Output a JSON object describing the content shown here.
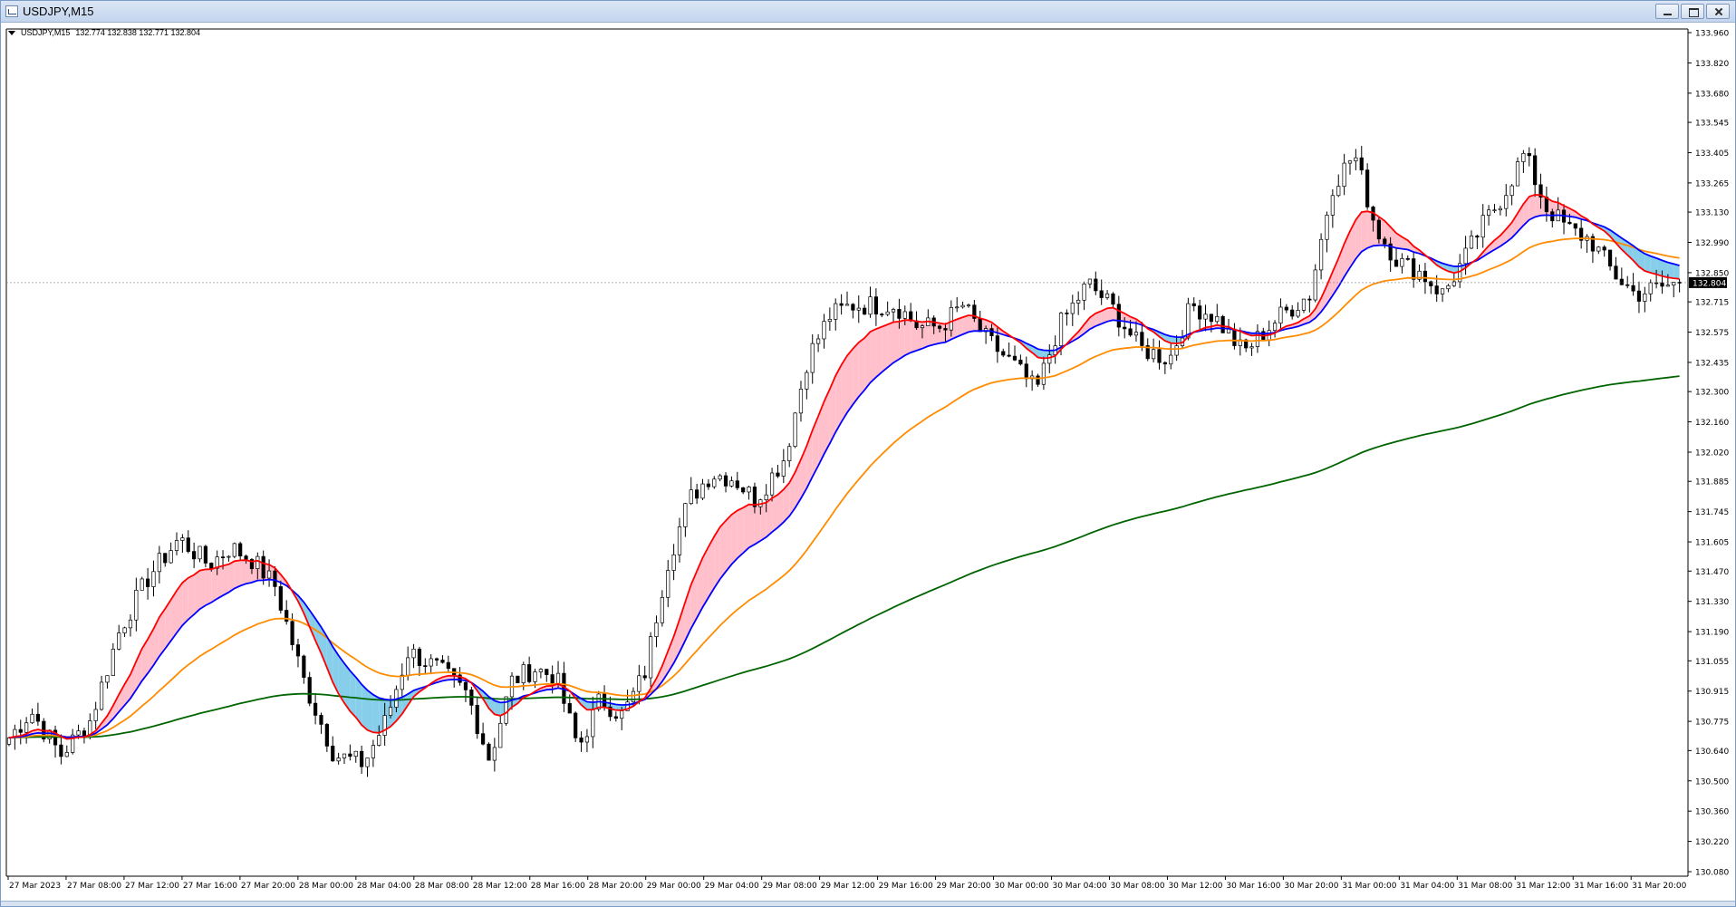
{
  "window": {
    "title": "USDJPY,M15",
    "title_icon": "chart-window-icon",
    "buttons": [
      "minimize",
      "maximize",
      "close"
    ]
  },
  "chart_header": {
    "symbol": "USDJPY,M15",
    "ohlc": "132.774 132.838 132.771 132.804"
  },
  "chart_data": {
    "type": "candlestick",
    "symbol": "USDJPY",
    "timeframe": "M15",
    "current_price": "132.804",
    "ylim": [
      130.08,
      133.96
    ],
    "y_ticks": [
      "133.960",
      "133.820",
      "133.680",
      "133.545",
      "133.405",
      "133.265",
      "133.130",
      "132.990",
      "132.850",
      "132.715",
      "132.575",
      "132.435",
      "132.300",
      "132.160",
      "132.020",
      "131.885",
      "131.745",
      "131.605",
      "131.470",
      "131.330",
      "131.190",
      "131.055",
      "130.915",
      "130.775",
      "130.640",
      "130.500",
      "130.360",
      "130.220",
      "130.080"
    ],
    "x_ticks": [
      "27 Mar 2023",
      "27 Mar 08:00",
      "27 Mar 12:00",
      "27 Mar 16:00",
      "27 Mar 20:00",
      "28 Mar 00:00",
      "28 Mar 04:00",
      "28 Mar 08:00",
      "28 Mar 12:00",
      "28 Mar 16:00",
      "28 Mar 20:00",
      "29 Mar 00:00",
      "29 Mar 04:00",
      "29 Mar 08:00",
      "29 Mar 12:00",
      "29 Mar 16:00",
      "29 Mar 20:00",
      "30 Mar 00:00",
      "30 Mar 04:00",
      "30 Mar 08:00",
      "30 Mar 12:00",
      "30 Mar 16:00",
      "30 Mar 20:00",
      "31 Mar 00:00",
      "31 Mar 04:00",
      "31 Mar 08:00",
      "31 Mar 12:00",
      "31 Mar 16:00",
      "31 Mar 20:00"
    ],
    "bar_count": 290,
    "price_path": [
      [
        0,
        130.7
      ],
      [
        6,
        130.82
      ],
      [
        14,
        130.62
      ],
      [
        22,
        130.78
      ],
      [
        30,
        131.2
      ],
      [
        38,
        131.45
      ],
      [
        46,
        131.62
      ],
      [
        54,
        131.5
      ],
      [
        60,
        131.58
      ],
      [
        66,
        131.52
      ],
      [
        72,
        131.4
      ],
      [
        80,
        130.95
      ],
      [
        88,
        130.62
      ],
      [
        96,
        130.58
      ],
      [
        102,
        130.78
      ],
      [
        108,
        131.1
      ],
      [
        116,
        131.02
      ],
      [
        124,
        130.9
      ],
      [
        130,
        130.6
      ],
      [
        136,
        130.96
      ],
      [
        142,
        131.02
      ],
      [
        148,
        130.98
      ],
      [
        154,
        130.65
      ],
      [
        160,
        130.88
      ],
      [
        166,
        130.8
      ],
      [
        172,
        131.0
      ],
      [
        178,
        131.5
      ],
      [
        184,
        131.8
      ],
      [
        190,
        131.92
      ],
      [
        196,
        131.9
      ],
      [
        202,
        131.8
      ],
      [
        210,
        132.0
      ],
      [
        216,
        132.45
      ],
      [
        222,
        132.65
      ],
      [
        228,
        132.7
      ],
      [
        234,
        132.7
      ],
      [
        240,
        132.7
      ],
      [
        246,
        132.6
      ],
      [
        252,
        132.6
      ],
      [
        258,
        132.7
      ],
      [
        264,
        132.55
      ],
      [
        272,
        132.42
      ],
      [
        278,
        132.3
      ],
      [
        284,
        132.6
      ],
      [
        292,
        132.8
      ],
      [
        298,
        132.7
      ],
      [
        306,
        132.5
      ],
      [
        314,
        132.45
      ],
      [
        320,
        132.7
      ],
      [
        326,
        132.65
      ],
      [
        334,
        132.48
      ],
      [
        344,
        132.65
      ],
      [
        352,
        132.75
      ],
      [
        358,
        133.25
      ],
      [
        364,
        133.4
      ],
      [
        370,
        133.05
      ],
      [
        376,
        132.9
      ],
      [
        382,
        132.85
      ],
      [
        388,
        132.75
      ],
      [
        394,
        132.92
      ],
      [
        398,
        133.05
      ],
      [
        404,
        133.2
      ],
      [
        410,
        133.4
      ],
      [
        416,
        133.15
      ],
      [
        422,
        133.05
      ],
      [
        428,
        133.0
      ],
      [
        434,
        132.85
      ],
      [
        440,
        132.75
      ],
      [
        446,
        132.78
      ],
      [
        452,
        132.8
      ]
    ],
    "indicators": [
      {
        "name": "MA fast",
        "color": "#ff0000"
      },
      {
        "name": "MA medium",
        "color": "#0000ff"
      },
      {
        "name": "MA slow",
        "color": "#ff8c00"
      },
      {
        "name": "MA long",
        "color": "#006400"
      }
    ],
    "fill_up_color": "#ffc0cb",
    "fill_down_color": "#87ceeb",
    "candle_color": "#000000",
    "price_label_bg": "#000000"
  }
}
